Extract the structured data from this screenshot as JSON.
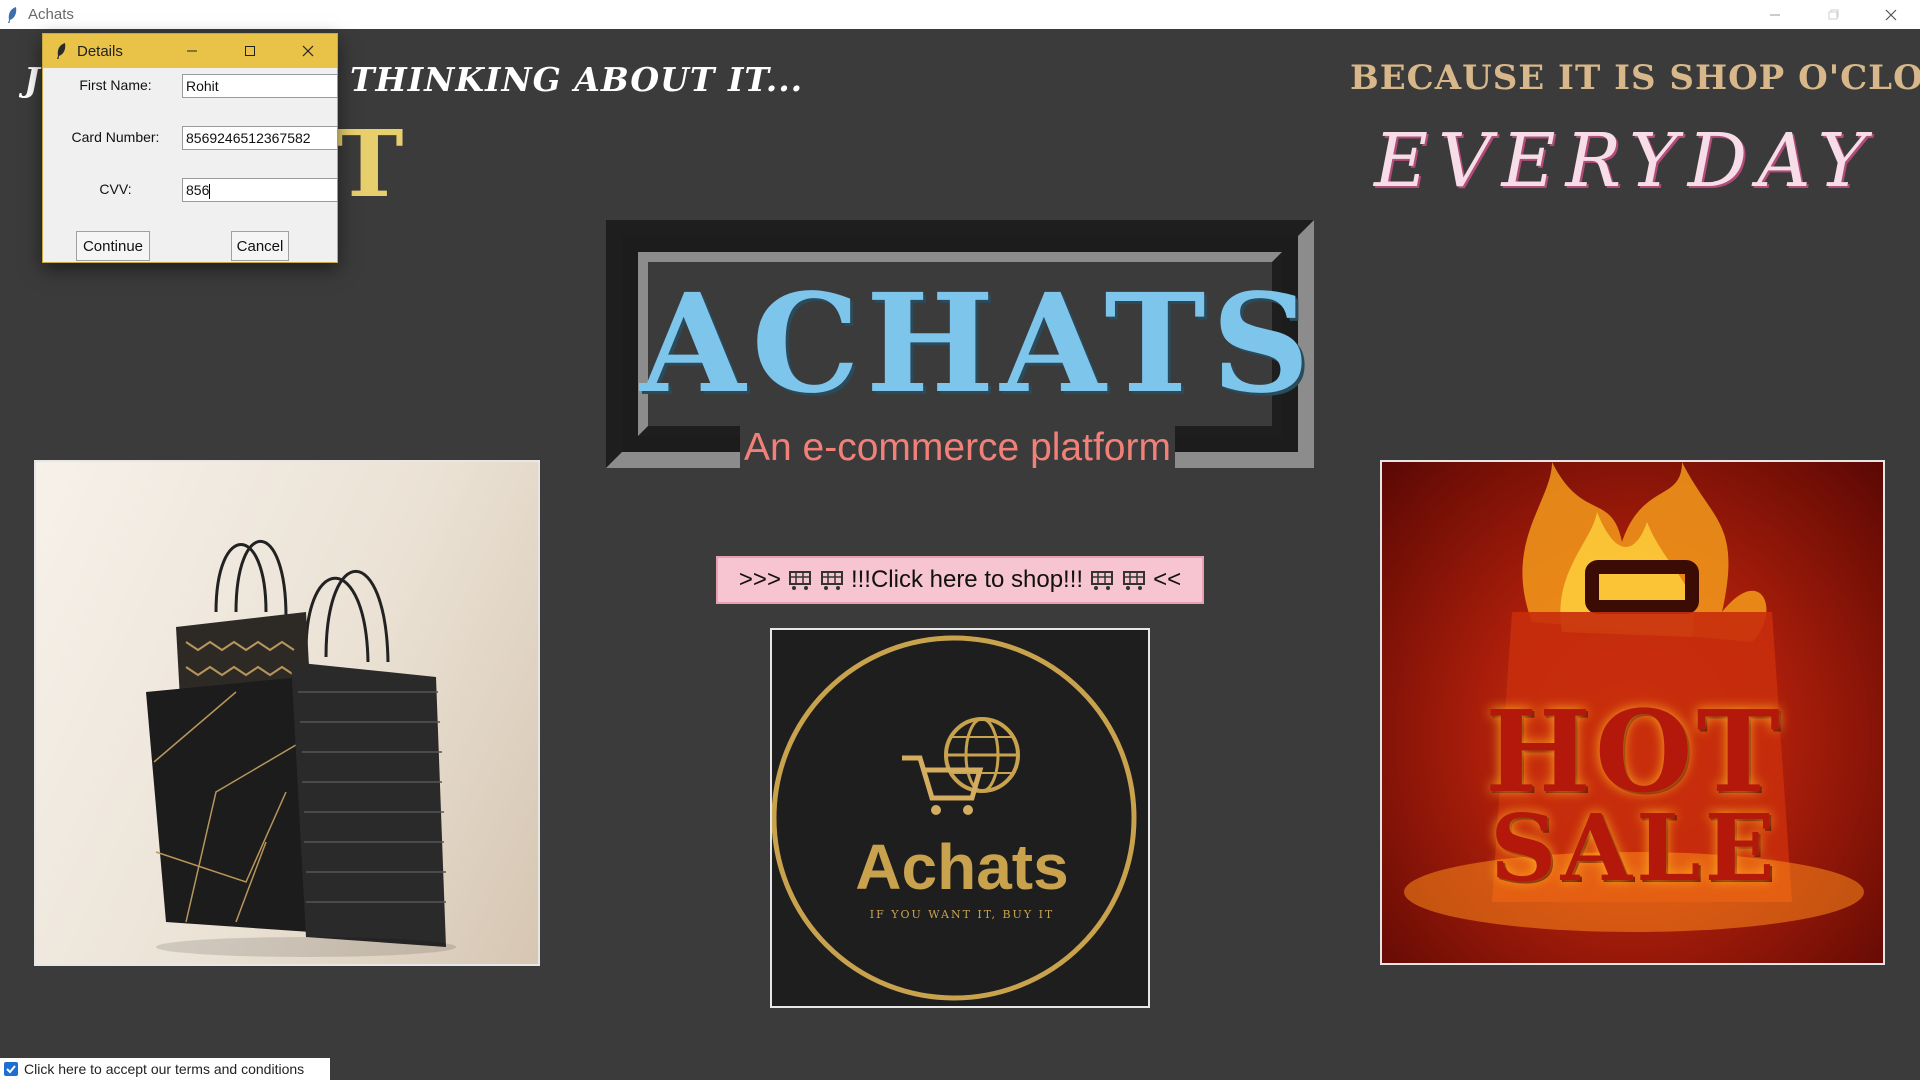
{
  "window": {
    "title": "Achats"
  },
  "headline": {
    "left_start": "J",
    "left_tagline": "THINKING ABOUT IT...",
    "left_gold_fragment": "T",
    "right_tagline": "BECAUSE IT IS SHOP O'CLOCK",
    "right_word": "EVERYDAY"
  },
  "logo": {
    "title": "ACHATS",
    "subtitle": "An e-commerce platform"
  },
  "shop_button": {
    "prefix": ">>>",
    "label": "!!!Click here to shop!!!",
    "suffix": "<<"
  },
  "brand_logo": {
    "name": "Achats",
    "slogan": "IF YOU WANT IT, BUY IT"
  },
  "hot_sale": {
    "line1": "HOT",
    "line2": "SALE"
  },
  "terms": {
    "label": "Click here to accept our terms and conditions",
    "checked": true
  },
  "dialog": {
    "title": "Details",
    "fields": [
      {
        "label": "First Name:",
        "value": "Rohit"
      },
      {
        "label": "Card Number:",
        "value": "8569246512367582"
      },
      {
        "label": "CVV:",
        "value": "856"
      }
    ],
    "continue_label": "Continue",
    "cancel_label": "Cancel"
  },
  "colors": {
    "background": "#3b3b3b",
    "logo_blue": "#7ec5ec",
    "subtitle_salmon": "#f08078",
    "shop_button_pink": "#f7c4d1",
    "dialog_titlebar": "#e8c347",
    "gold": "#e8cf6e"
  }
}
